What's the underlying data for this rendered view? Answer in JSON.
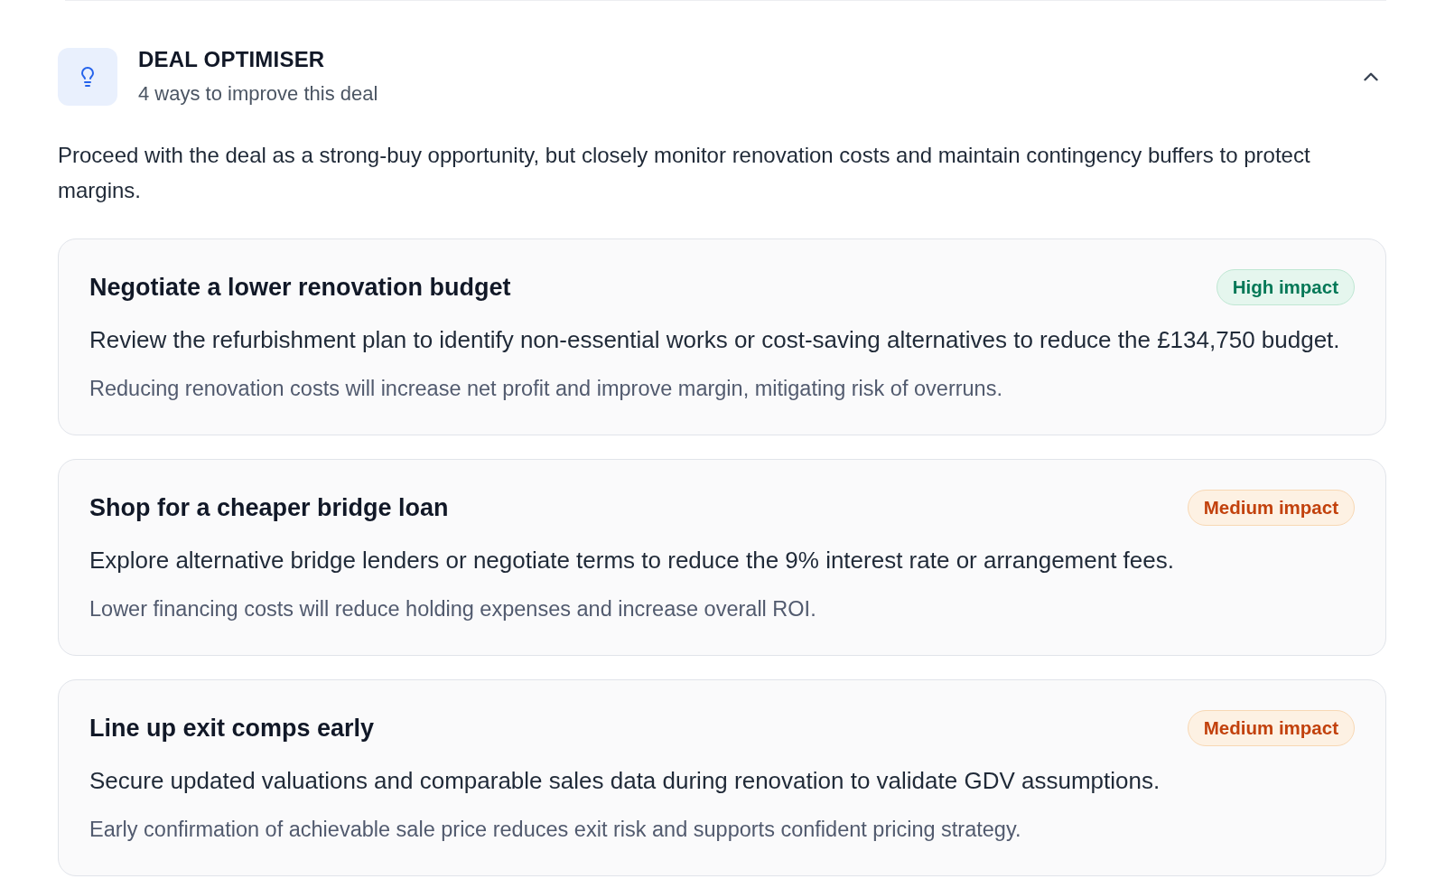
{
  "header": {
    "title": "DEAL OPTIMISER",
    "subtitle": "4 ways to improve this deal",
    "expanded": true
  },
  "summary": "Proceed with the deal as a strong-buy opportunity, but closely monitor renovation costs and maintain contingency buffers to protect margins.",
  "suggestions": [
    {
      "title": "Negotiate a lower renovation budget",
      "impact": {
        "kind": "high",
        "label": "High impact"
      },
      "description": "Review the refurbishment plan to identify non-essential works or cost-saving alternatives to reduce the £134,750 budget.",
      "rationale": "Reducing renovation costs will increase net profit and improve margin, mitigating risk of overruns."
    },
    {
      "title": "Shop for a cheaper bridge loan",
      "impact": {
        "kind": "medium",
        "label": "Medium impact"
      },
      "description": "Explore alternative bridge lenders or negotiate terms to reduce the 9% interest rate or arrangement fees.",
      "rationale": "Lower financing costs will reduce holding expenses and increase overall ROI."
    },
    {
      "title": "Line up exit comps early",
      "impact": {
        "kind": "medium",
        "label": "Medium impact"
      },
      "description": "Secure updated valuations and comparable sales data during renovation to validate GDV assumptions.",
      "rationale": "Early confirmation of achievable sale price reduces exit risk and supports confident pricing strategy."
    }
  ]
}
